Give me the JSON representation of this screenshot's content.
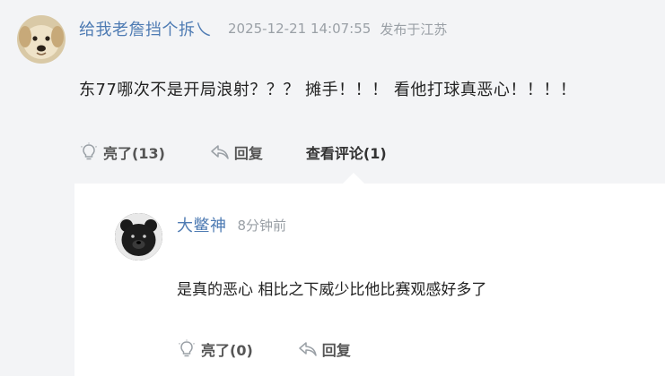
{
  "post": {
    "username": "给我老詹挡个拆乀",
    "time": "2025-12-21 14:07:55",
    "location": "发布于江苏",
    "content": "东77哪次不是开局浪射？？？ 摊手！！！ 看他打球真恶心！！！！",
    "actions": {
      "like_label": "亮了(13)",
      "reply_label": "回复",
      "view_comments_label": "查看评论(1)"
    }
  },
  "reply": {
    "username": "大鳖神",
    "time": "8分钟前",
    "content": "是真的恶心 相比之下威少比他比赛观感好多了",
    "actions": {
      "like_label": "亮了(0)",
      "reply_label": "回复"
    }
  },
  "colors": {
    "username": "#4e7bb3",
    "meta": "#9aa0a6",
    "background": "#f3f4f6",
    "reply_background": "#ffffff"
  },
  "icons": {
    "like": "lightbulb-icon",
    "reply": "reply-arrow-icon"
  }
}
